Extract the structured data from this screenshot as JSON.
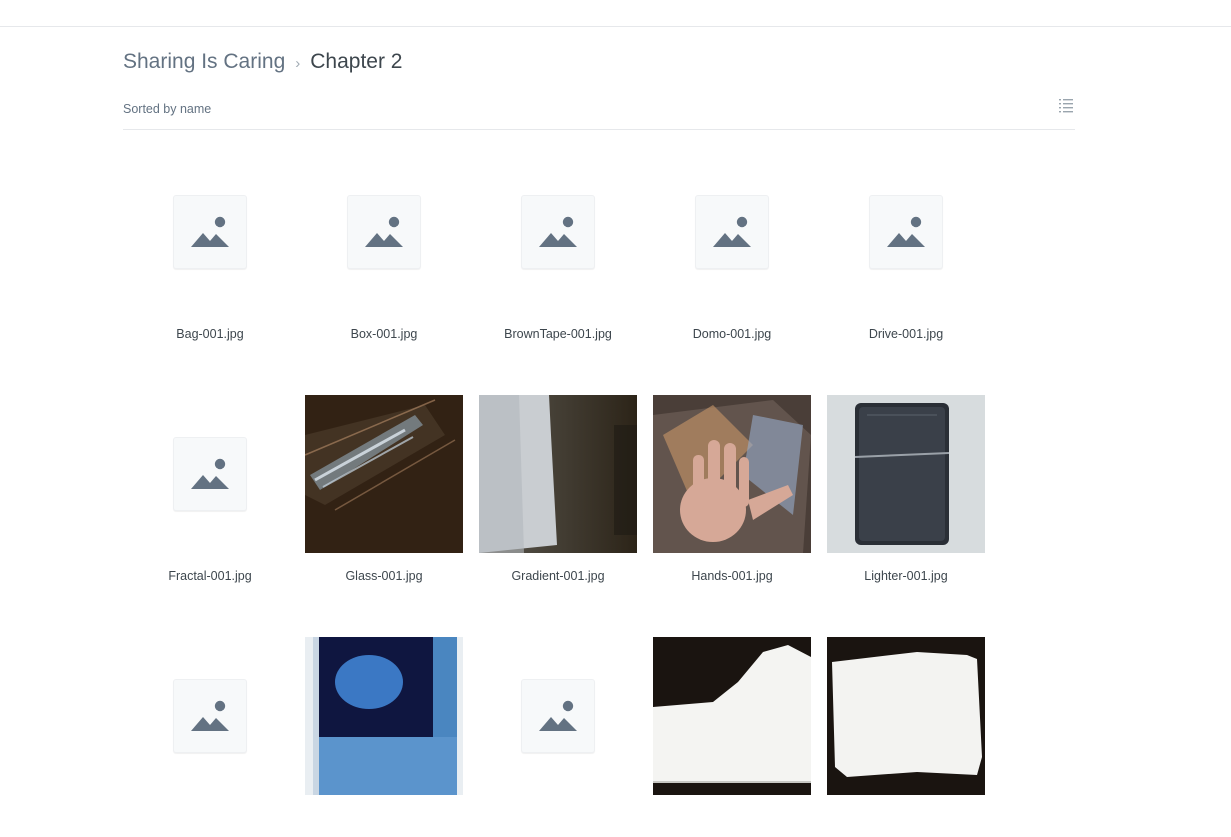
{
  "breadcrumb": {
    "parent": "Sharing Is Caring",
    "separator": "›",
    "current": "Chapter 2"
  },
  "sort": {
    "label": "Sorted by name"
  },
  "icons": {
    "placeholder": "image-placeholder-icon",
    "view_toggle": "list-view-icon"
  },
  "colors": {
    "placeholder_glyph": "#637282",
    "divider": "#e6e8eb"
  },
  "files": [
    {
      "name": "Bag-001.jpg",
      "thumb": "placeholder"
    },
    {
      "name": "Box-001.jpg",
      "thumb": "placeholder"
    },
    {
      "name": "BrownTape-001.jpg",
      "thumb": "placeholder"
    },
    {
      "name": "Domo-001.jpg",
      "thumb": "placeholder"
    },
    {
      "name": "Drive-001.jpg",
      "thumb": "placeholder"
    },
    {
      "name": "Fractal-001.jpg",
      "thumb": "placeholder"
    },
    {
      "name": "Glass-001.jpg",
      "thumb": "photo-glass"
    },
    {
      "name": "Gradient-001.jpg",
      "thumb": "photo-gradient"
    },
    {
      "name": "Hands-001.jpg",
      "thumb": "photo-hands"
    },
    {
      "name": "Lighter-001.jpg",
      "thumb": "photo-lighter"
    },
    {
      "name": "",
      "thumb": "placeholder"
    },
    {
      "name": "",
      "thumb": "photo-blue-circle"
    },
    {
      "name": "",
      "thumb": "placeholder"
    },
    {
      "name": "",
      "thumb": "photo-paper-torn"
    },
    {
      "name": "",
      "thumb": "photo-paper"
    }
  ]
}
